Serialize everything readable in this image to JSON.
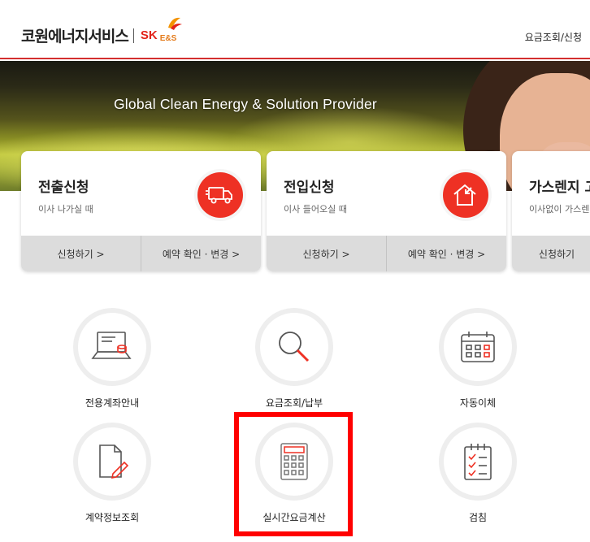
{
  "header": {
    "logo_text": "코원에너지서비스",
    "logo_sk": "SK",
    "logo_es": "E&S",
    "link": "요금조회/신청"
  },
  "hero": {
    "title": "Global Clean Energy & Solution Provider"
  },
  "cards": [
    {
      "title": "전출신청",
      "subtitle": "이사 나가실 때",
      "icon": "moving-truck-icon",
      "actions": [
        "신청하기 >",
        "예약 확인 · 변경 >"
      ]
    },
    {
      "title": "전입신청",
      "subtitle": "이사 들어오실 때",
      "icon": "house-arrow-icon",
      "actions": [
        "신청하기 >",
        "예약 확인 · 변경 >"
      ]
    },
    {
      "title": "가스렌지 고",
      "subtitle": "이사없이 가스렌",
      "actions": [
        "신청하기 "
      ]
    }
  ],
  "menu": [
    {
      "label": "전용계좌안내",
      "icon": "laptop-coins-icon"
    },
    {
      "label": "요금조회/납부",
      "icon": "magnifier-icon"
    },
    {
      "label": "자동이체",
      "icon": "calendar-icon"
    },
    {
      "label": "계약정보조회",
      "icon": "document-pen-icon"
    },
    {
      "label": "실시간요금계산",
      "icon": "calculator-icon"
    },
    {
      "label": "검침",
      "icon": "checklist-icon"
    }
  ],
  "colors": {
    "accent": "#ee3124",
    "highlight": "#ff0000"
  }
}
